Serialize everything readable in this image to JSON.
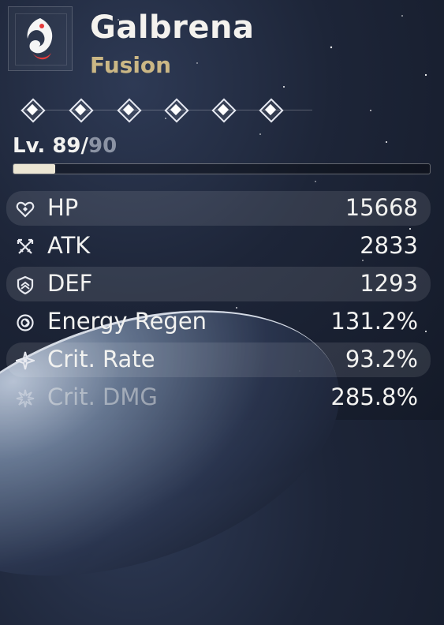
{
  "character": {
    "name": "Galbrena",
    "element": "Fusion"
  },
  "sequence": {
    "nodes": 6
  },
  "level": {
    "current": "Lv. 89/",
    "max": "90",
    "progress": 0.1
  },
  "stats": [
    {
      "label": "HP",
      "value": "15668",
      "icon": "heart-icon"
    },
    {
      "label": "ATK",
      "value": "2833",
      "icon": "crossed-swords-icon"
    },
    {
      "label": "DEF",
      "value": "1293",
      "icon": "shield-icon"
    },
    {
      "label": "Energy Regen",
      "value": "131.2%",
      "icon": "energy-swirl-icon"
    },
    {
      "label": "Crit. Rate",
      "value": "93.2%",
      "icon": "crit-star-icon"
    },
    {
      "label": "Crit. DMG",
      "value": "285.8%",
      "icon": "crit-burst-icon"
    }
  ],
  "colors": {
    "element": "#cbb785",
    "level_max": "#8b93a4",
    "bar_fill": "#ece6d4"
  }
}
